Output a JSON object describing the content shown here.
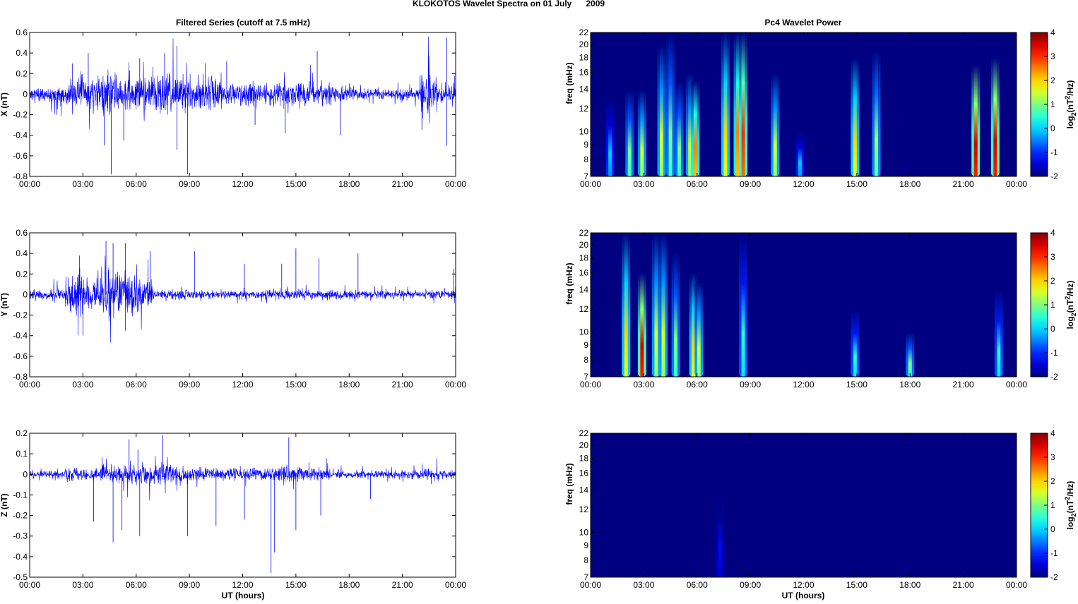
{
  "title": "KLOKOTOS Wavelet Spectra on 01 July      2009",
  "left_title": "Filtered Series (cutoff at 7.5 mHz)",
  "right_title": "Pc4 Wavelet Power",
  "xlabel": "UT (hours)",
  "freq_label": "freq (mHz)",
  "colorbar_label": {
    "base": "log",
    "sub": "2",
    "mid": "(nT",
    "sup": "2",
    "end": "/Hz)"
  },
  "colors": {
    "trace": "#0000ff",
    "axis": "#000000"
  },
  "chart_data": [
    {
      "type": "line",
      "component": "X",
      "ylabel": "X (nT)",
      "ylim": [
        -0.8,
        0.6
      ],
      "yticks": [
        "0.6",
        "0.4",
        "0.2",
        "0",
        "-0.2",
        "-0.4",
        "-0.6",
        "-0.8"
      ],
      "ytick_values": [
        0.6,
        0.4,
        0.2,
        0,
        -0.2,
        -0.4,
        -0.6,
        -0.8
      ],
      "xlim_hours": [
        0,
        24
      ],
      "xticks": [
        "00:00",
        "03:00",
        "06:00",
        "09:00",
        "12:00",
        "15:00",
        "18:00",
        "21:00",
        "00:00"
      ],
      "hourly_envelope_nT": [
        0.06,
        0.08,
        0.12,
        0.15,
        0.2,
        0.15,
        0.15,
        0.2,
        0.2,
        0.15,
        0.15,
        0.1,
        0.1,
        0.1,
        0.12,
        0.12,
        0.1,
        0.08,
        0.06,
        0.05,
        0.05,
        0.05,
        0.2,
        0.08
      ],
      "spikes": [
        [
          4.6,
          -0.78
        ],
        [
          8.9,
          -0.78
        ],
        [
          7.6,
          0.4
        ],
        [
          8.3,
          0.47
        ],
        [
          23.5,
          0.55
        ],
        [
          16.2,
          0.42
        ],
        [
          3.3,
          0.4
        ],
        [
          4.2,
          -0.5
        ],
        [
          8.3,
          -0.54
        ],
        [
          17.5,
          -0.4
        ],
        [
          23.5,
          -0.5
        ],
        [
          22.1,
          -0.35
        ],
        [
          5.3,
          -0.45
        ],
        [
          6.2,
          0.35
        ],
        [
          2.4,
          0.3
        ],
        [
          11.1,
          0.32
        ],
        [
          14.4,
          -0.38
        ],
        [
          12.7,
          -0.3
        ],
        [
          9.9,
          0.3
        ]
      ]
    },
    {
      "type": "line",
      "component": "Y",
      "ylabel": "Y (nT)",
      "ylim": [
        -0.8,
        0.6
      ],
      "yticks": [
        "0.6",
        "0.4",
        "0.2",
        "0",
        "-0.2",
        "-0.4",
        "-0.6",
        "-0.8"
      ],
      "ytick_values": [
        0.6,
        0.4,
        0.2,
        0,
        -0.2,
        -0.4,
        -0.6,
        -0.8
      ],
      "xlim_hours": [
        0,
        24
      ],
      "xticks": [
        "00:00",
        "03:00",
        "06:00",
        "09:00",
        "12:00",
        "15:00",
        "18:00",
        "21:00",
        "00:00"
      ],
      "hourly_envelope_nT": [
        0.05,
        0.05,
        0.2,
        0.15,
        0.25,
        0.2,
        0.15,
        0.05,
        0.05,
        0.04,
        0.04,
        0.04,
        0.04,
        0.04,
        0.05,
        0.05,
        0.05,
        0.04,
        0.04,
        0.04,
        0.04,
        0.04,
        0.04,
        0.04
      ],
      "spikes": [
        [
          4.3,
          0.52
        ],
        [
          4.7,
          0.5
        ],
        [
          5.4,
          0.5
        ],
        [
          6.8,
          0.42
        ],
        [
          9.3,
          0.42
        ],
        [
          15,
          0.45
        ],
        [
          18.5,
          0.4
        ],
        [
          3,
          -0.4
        ],
        [
          5.4,
          -0.35
        ],
        [
          23.9,
          0.25
        ],
        [
          2.8,
          0.38
        ],
        [
          12.1,
          0.3
        ],
        [
          16.3,
          0.35
        ],
        [
          14.2,
          0.3
        ]
      ]
    },
    {
      "type": "line",
      "component": "Z",
      "ylabel": "Z (nT)",
      "ylim": [
        -0.5,
        0.2
      ],
      "yticks": [
        "0.2",
        "0.1",
        "0",
        "-0.1",
        "-0.2",
        "-0.3",
        "-0.4",
        "-0.5"
      ],
      "ytick_values": [
        0.2,
        0.1,
        0,
        -0.1,
        -0.2,
        -0.3,
        -0.4,
        -0.5
      ],
      "xlim_hours": [
        0,
        24
      ],
      "xticks": [
        "00:00",
        "03:00",
        "06:00",
        "09:00",
        "12:00",
        "15:00",
        "18:00",
        "21:00",
        "00:00"
      ],
      "hourly_envelope_nT": [
        0.02,
        0.02,
        0.03,
        0.03,
        0.04,
        0.05,
        0.05,
        0.05,
        0.04,
        0.03,
        0.03,
        0.03,
        0.03,
        0.03,
        0.04,
        0.03,
        0.03,
        0.02,
        0.02,
        0.02,
        0.02,
        0.02,
        0.03,
        0.02
      ],
      "spikes": [
        [
          13.6,
          -0.48
        ],
        [
          5.6,
          0.17
        ],
        [
          7.5,
          0.19
        ],
        [
          14.6,
          0.18
        ],
        [
          4.7,
          -0.33
        ],
        [
          6.2,
          -0.3
        ],
        [
          8.9,
          -0.3
        ],
        [
          13.8,
          -0.38
        ],
        [
          15,
          -0.27
        ],
        [
          10.5,
          -0.25
        ],
        [
          3.6,
          -0.23
        ],
        [
          5.2,
          -0.27
        ],
        [
          12.1,
          -0.22
        ],
        [
          16.4,
          -0.2
        ],
        [
          19.2,
          -0.12
        ],
        [
          6.1,
          0.12
        ]
      ]
    },
    {
      "type": "heatmap",
      "component": "X",
      "ylabel": "freq (mHz)",
      "ylim_mHz": [
        7,
        22
      ],
      "yscale": "log",
      "yticks": [
        "22",
        "20",
        "18",
        "16",
        "14",
        "12",
        "10",
        "9",
        "8",
        "7"
      ],
      "ytick_values": [
        22,
        20,
        18,
        16,
        14,
        12,
        10,
        9,
        8,
        7
      ],
      "xticks": [
        "00:00",
        "03:00",
        "06:00",
        "09:00",
        "12:00",
        "15:00",
        "18:00",
        "21:00",
        "00:00"
      ],
      "clim": [
        -2,
        4
      ],
      "cticks": [
        "4",
        "3",
        "2",
        "1",
        "0",
        "-1",
        "-2"
      ],
      "ctick_values": [
        4,
        3,
        2,
        1,
        0,
        -1,
        -2
      ],
      "bursts_hour_fmax_power": [
        [
          1.1,
          13,
          0
        ],
        [
          2.2,
          14,
          1
        ],
        [
          2.9,
          14,
          1.5
        ],
        [
          4.0,
          20,
          1.5
        ],
        [
          4.5,
          22,
          1
        ],
        [
          5.0,
          15,
          1
        ],
        [
          5.6,
          16,
          1.5
        ],
        [
          5.9,
          15,
          2.5
        ],
        [
          7.6,
          22,
          2
        ],
        [
          8.3,
          22,
          2.5
        ],
        [
          8.6,
          22,
          3
        ],
        [
          10.4,
          16,
          1.5
        ],
        [
          11.8,
          10,
          0
        ],
        [
          14.9,
          18,
          2
        ],
        [
          16.1,
          19,
          1.2
        ],
        [
          21.7,
          17,
          3.5
        ],
        [
          22.8,
          18,
          3.5
        ]
      ]
    },
    {
      "type": "heatmap",
      "component": "Y",
      "ylabel": "freq (mHz)",
      "ylim_mHz": [
        7,
        22
      ],
      "yscale": "log",
      "yticks": [
        "22",
        "20",
        "18",
        "16",
        "14",
        "12",
        "10",
        "9",
        "8",
        "7"
      ],
      "ytick_values": [
        22,
        20,
        18,
        16,
        14,
        12,
        10,
        9,
        8,
        7
      ],
      "xticks": [
        "00:00",
        "03:00",
        "06:00",
        "09:00",
        "12:00",
        "15:00",
        "18:00",
        "21:00",
        "00:00"
      ],
      "clim": [
        -2,
        4
      ],
      "cticks": [
        "4",
        "3",
        "2",
        "1",
        "0",
        "-1",
        "-2"
      ],
      "ctick_values": [
        4,
        3,
        2,
        1,
        0,
        -1,
        -2
      ],
      "bursts_hour_fmax_power": [
        [
          2.0,
          22,
          2
        ],
        [
          2.9,
          16,
          3.5
        ],
        [
          3.7,
          22,
          1.5
        ],
        [
          4.1,
          22,
          1.5
        ],
        [
          4.8,
          19,
          1
        ],
        [
          5.8,
          16,
          2
        ],
        [
          6.1,
          15,
          1.5
        ],
        [
          8.6,
          22,
          0.5
        ],
        [
          14.9,
          12,
          0.5
        ],
        [
          18.0,
          10,
          1
        ],
        [
          23.0,
          14,
          0.5
        ]
      ]
    },
    {
      "type": "heatmap",
      "component": "Z",
      "ylabel": "freq (mHz)",
      "ylim_mHz": [
        7,
        22
      ],
      "yscale": "log",
      "yticks": [
        "22",
        "20",
        "18",
        "16",
        "14",
        "12",
        "10",
        "9",
        "8",
        "7"
      ],
      "ytick_values": [
        22,
        20,
        18,
        16,
        14,
        12,
        10,
        9,
        8,
        7
      ],
      "xticks": [
        "00:00",
        "03:00",
        "06:00",
        "09:00",
        "12:00",
        "15:00",
        "18:00",
        "21:00",
        "00:00"
      ],
      "clim": [
        -2,
        4
      ],
      "cticks": [
        "4",
        "3",
        "2",
        "1",
        "0",
        "-1",
        "-2"
      ],
      "ctick_values": [
        4,
        3,
        2,
        1,
        0,
        -1,
        -2
      ],
      "bursts_hour_fmax_power": [
        [
          7.3,
          15,
          -1.2
        ]
      ]
    }
  ]
}
